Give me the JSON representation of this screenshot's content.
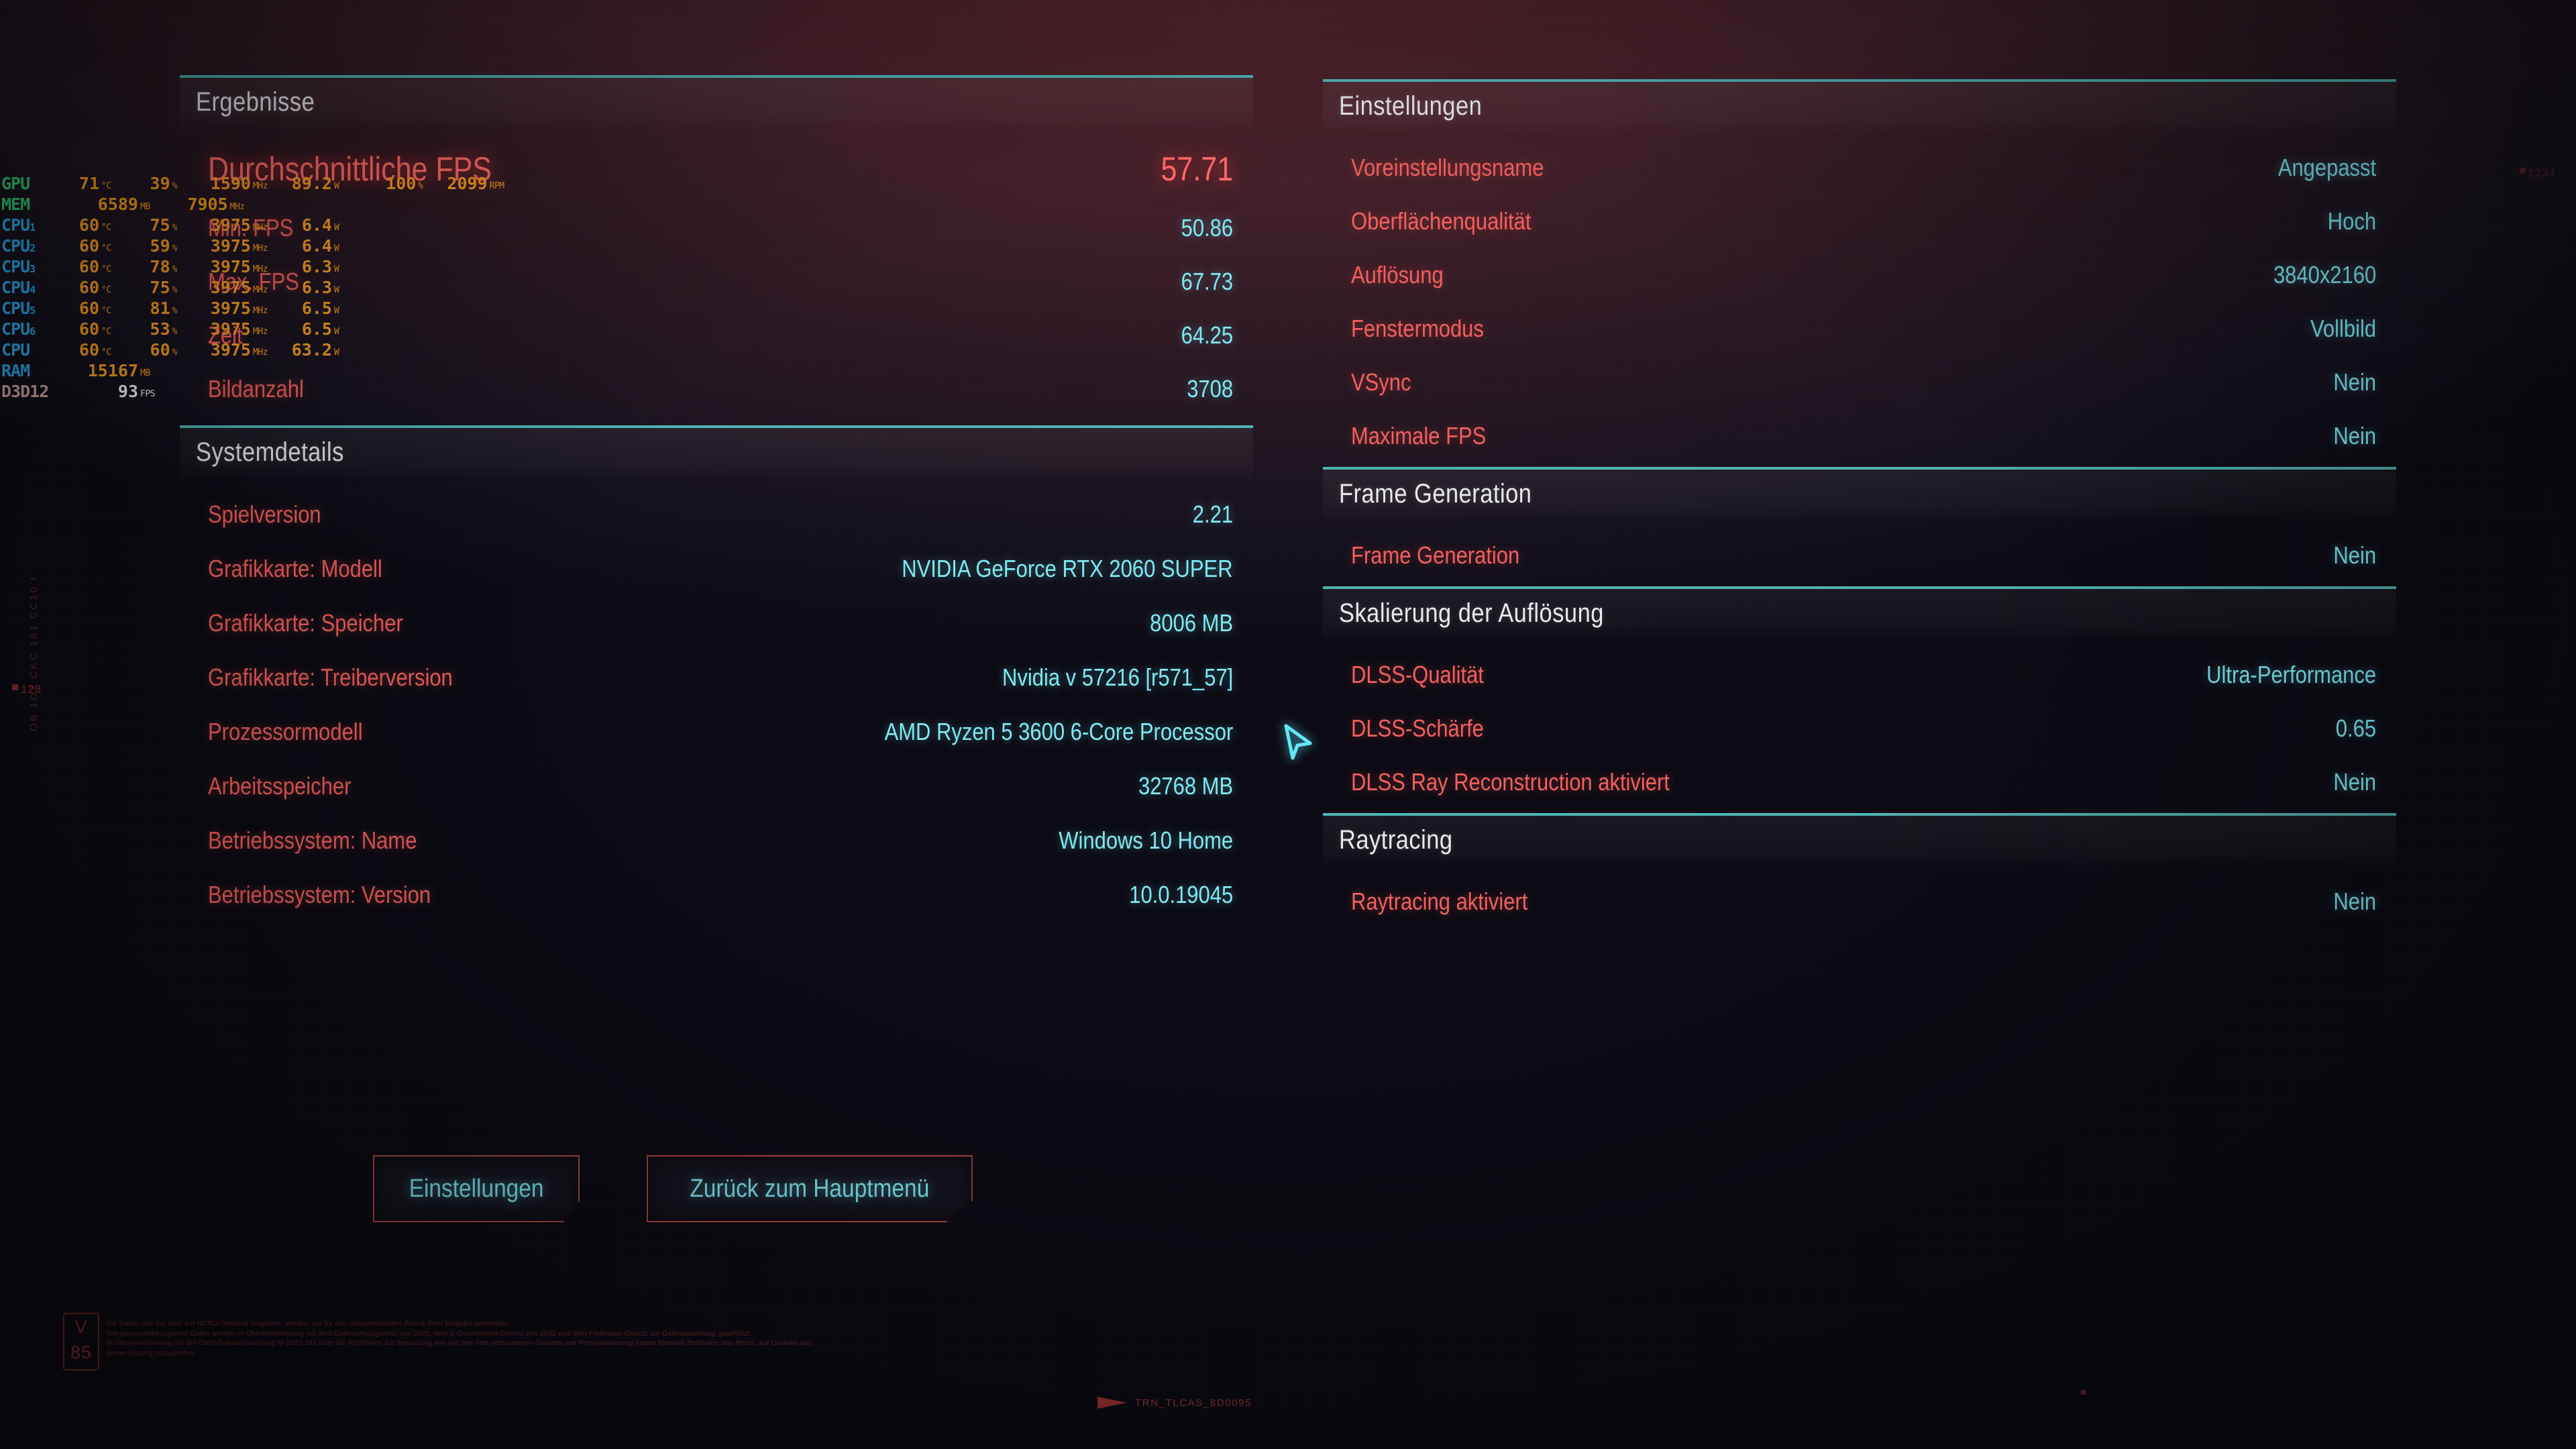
{
  "results": {
    "heading": "Ergebnisse",
    "rows": [
      {
        "label": "Durchschnittliche FPS",
        "value": "57.71",
        "hero": true
      },
      {
        "label": "Min. FPS",
        "value": "50.86"
      },
      {
        "label": "Max. FPS",
        "value": "67.73"
      },
      {
        "label": "Zeit",
        "value": "64.25"
      },
      {
        "label": "Bildanzahl",
        "value": "3708"
      }
    ]
  },
  "system_details": {
    "heading": "Systemdetails",
    "rows": [
      {
        "label": "Spielversion",
        "value": "2.21"
      },
      {
        "label": "Grafikkarte: Modell",
        "value": "NVIDIA GeForce RTX 2060 SUPER"
      },
      {
        "label": "Grafikkarte: Speicher",
        "value": "8006 MB"
      },
      {
        "label": "Grafikkarte: Treiberversion",
        "value": "Nvidia v 57216 [r571_57]"
      },
      {
        "label": "Prozessormodell",
        "value": "AMD Ryzen 5 3600 6-Core Processor"
      },
      {
        "label": "Arbeitsspeicher",
        "value": "32768 MB"
      },
      {
        "label": "Betriebssystem: Name",
        "value": "Windows 10 Home"
      },
      {
        "label": "Betriebssystem: Version",
        "value": "10.0.19045"
      }
    ]
  },
  "settings": {
    "heading": "Einstellungen",
    "rows": [
      {
        "label": "Voreinstellungsname",
        "value": "Angepasst"
      },
      {
        "label": "Oberflächenqualität",
        "value": "Hoch"
      },
      {
        "label": "Auflösung",
        "value": "3840x2160"
      },
      {
        "label": "Fenstermodus",
        "value": "Vollbild"
      },
      {
        "label": "VSync",
        "value": "Nein"
      },
      {
        "label": "Maximale FPS",
        "value": "Nein"
      }
    ]
  },
  "frame_generation": {
    "heading": "Frame Generation",
    "rows": [
      {
        "label": "Frame Generation",
        "value": "Nein"
      }
    ]
  },
  "resolution_scaling": {
    "heading": "Skalierung der Auflösung",
    "rows": [
      {
        "label": "DLSS-Qualität",
        "value": "Ultra-Performance"
      },
      {
        "label": "DLSS-Schärfe",
        "value": "0.65"
      },
      {
        "label": "DLSS Ray Reconstruction aktiviert",
        "value": "Nein"
      }
    ]
  },
  "raytracing": {
    "heading": "Raytracing",
    "rows": [
      {
        "label": "Raytracing aktiviert",
        "value": "Nein"
      }
    ]
  },
  "buttons": {
    "settings_label": "Einstellungen",
    "back_label": "Zurück zum Hauptmenü"
  },
  "osd": {
    "rows": [
      {
        "name": "GPU",
        "sub": "",
        "type": "gpu",
        "cells": [
          {
            "v": "71",
            "u": "°C",
            "w": "c-temp"
          },
          {
            "v": "39",
            "u": "%",
            "w": "c-load"
          },
          {
            "v": "1590",
            "u": "MHz",
            "w": "c-clk"
          },
          {
            "v": "89.2",
            "u": "W",
            "w": "c-pwr"
          },
          {
            "v": "100",
            "u": "%",
            "w": "c-fan"
          },
          {
            "v": "2099",
            "u": "RPM",
            "w": "c-rpm"
          }
        ]
      },
      {
        "name": "MEM",
        "sub": "",
        "type": "mem",
        "cells": [
          {
            "v": "6589",
            "u": "MB",
            "w": "c-memu"
          },
          {
            "v": "7905",
            "u": "MHz",
            "w": "c-memc"
          }
        ]
      },
      {
        "name": "CPU",
        "sub": "1",
        "type": "cpu",
        "cells": [
          {
            "v": "60",
            "u": "°C",
            "w": "c-temp"
          },
          {
            "v": "75",
            "u": "%",
            "w": "c-load"
          },
          {
            "v": "3975",
            "u": "MHz",
            "w": "c-clk"
          },
          {
            "v": "6.4",
            "u": "W",
            "w": "c-pwr"
          }
        ]
      },
      {
        "name": "CPU",
        "sub": "2",
        "type": "cpu",
        "cells": [
          {
            "v": "60",
            "u": "°C",
            "w": "c-temp"
          },
          {
            "v": "59",
            "u": "%",
            "w": "c-load"
          },
          {
            "v": "3975",
            "u": "MHz",
            "w": "c-clk"
          },
          {
            "v": "6.4",
            "u": "W",
            "w": "c-pwr"
          }
        ]
      },
      {
        "name": "CPU",
        "sub": "3",
        "type": "cpu",
        "cells": [
          {
            "v": "60",
            "u": "°C",
            "w": "c-temp"
          },
          {
            "v": "78",
            "u": "%",
            "w": "c-load"
          },
          {
            "v": "3975",
            "u": "MHz",
            "w": "c-clk"
          },
          {
            "v": "6.3",
            "u": "W",
            "w": "c-pwr"
          }
        ]
      },
      {
        "name": "CPU",
        "sub": "4",
        "type": "cpu",
        "cells": [
          {
            "v": "60",
            "u": "°C",
            "w": "c-temp"
          },
          {
            "v": "75",
            "u": "%",
            "w": "c-load"
          },
          {
            "v": "3975",
            "u": "MHz",
            "w": "c-clk"
          },
          {
            "v": "6.3",
            "u": "W",
            "w": "c-pwr"
          }
        ]
      },
      {
        "name": "CPU",
        "sub": "5",
        "type": "cpu",
        "cells": [
          {
            "v": "60",
            "u": "°C",
            "w": "c-temp"
          },
          {
            "v": "81",
            "u": "%",
            "w": "c-load"
          },
          {
            "v": "3975",
            "u": "MHz",
            "w": "c-clk"
          },
          {
            "v": "6.5",
            "u": "W",
            "w": "c-pwr"
          }
        ]
      },
      {
        "name": "CPU",
        "sub": "6",
        "type": "cpu",
        "cells": [
          {
            "v": "60",
            "u": "°C",
            "w": "c-temp"
          },
          {
            "v": "53",
            "u": "%",
            "w": "c-load"
          },
          {
            "v": "3975",
            "u": "MHz",
            "w": "c-clk"
          },
          {
            "v": "6.5",
            "u": "W",
            "w": "c-pwr"
          }
        ]
      },
      {
        "name": "CPU",
        "sub": "",
        "type": "cpu",
        "cells": [
          {
            "v": "60",
            "u": "°C",
            "w": "c-temp"
          },
          {
            "v": "60",
            "u": "%",
            "w": "c-load"
          },
          {
            "v": "3975",
            "u": "MHz",
            "w": "c-clk"
          },
          {
            "v": "63.2",
            "u": "W",
            "w": "c-pwr"
          }
        ]
      },
      {
        "name": "RAM",
        "sub": "",
        "type": "ram",
        "cells": [
          {
            "v": "15167",
            "u": "MB",
            "w": "c-ramu"
          }
        ]
      },
      {
        "name": "D3D12",
        "sub": "",
        "type": "api",
        "cells": [
          {
            "v": "93",
            "u": "FPS",
            "w": "c-fps",
            "white": true
          }
        ]
      }
    ]
  },
  "chrome": {
    "version_badge_top": "V",
    "version_badge_bottom": "85",
    "legal_lines": [
      "Die Daten, die Sie über ein NCRD-Terminal eingeben, werden nur für den entsprechenden Zweck Ihrer Eingabe verwendet.",
      "Ihre personenbezogenen Daten werden in Übereinstimmung mit dem Datenschutzgesetz von 2025, dem E-Government-Gesetz von 2032 und dem Föderalen Gesetz zur Datensammlung geschützt.",
      "In Übereinstimmung mit der OMB-Bekanntmachung M-1022-242 über die Richtlinien zur Benutzung von mit dem Net verbundenen Geräten und Personalisierung haben föderale Behörden das Recht, auf Cookies aus",
      "dieser Sitzung zuzugreifen."
    ],
    "trn_code": "TRN_TLCAS_8D0095",
    "left_vertical_code": "OB 1D2 CKC 151 CC10 I",
    "left_number": "123",
    "top_right_number": "1234"
  },
  "colors": {
    "accent_teal": "#4fb4b4",
    "label_red": "#f0605e",
    "value_cyan": "#7fe9f2",
    "hero_red": "#ff6b66",
    "osd_orange": "#f59c1e",
    "osd_green": "#2ecc71",
    "osd_blue": "#2aa7e8",
    "button_border": "#b24a45"
  }
}
